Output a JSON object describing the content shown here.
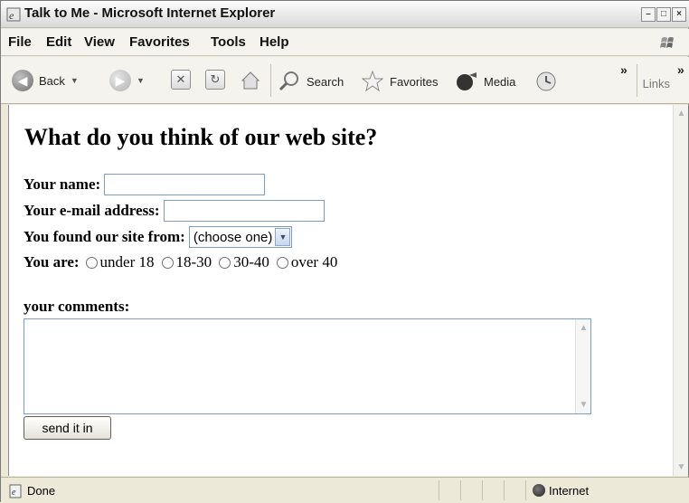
{
  "window": {
    "title": "Talk to Me - Microsoft Internet Explorer"
  },
  "menu": [
    "File",
    "Edit",
    "View",
    "Favorites",
    "Tools",
    "Help"
  ],
  "toolbar": {
    "back_label": "Back",
    "search_label": "Search",
    "favorites_label": "Favorites",
    "media_label": "Media",
    "overflow_glyph": "»",
    "links_label": "Links"
  },
  "page": {
    "heading": "What do you think of our web site?",
    "name_label": "Your name:",
    "email_label": "Your e-mail address:",
    "found_label": "You found our site from:",
    "found_selected": "(choose one)",
    "age_label": "You are:",
    "age_options": [
      "under 18",
      "18-30",
      "30-40",
      "over 40"
    ],
    "comments_label": "your comments:",
    "submit_label": "send it in"
  },
  "status": {
    "text": "Done",
    "zone": "Internet"
  }
}
